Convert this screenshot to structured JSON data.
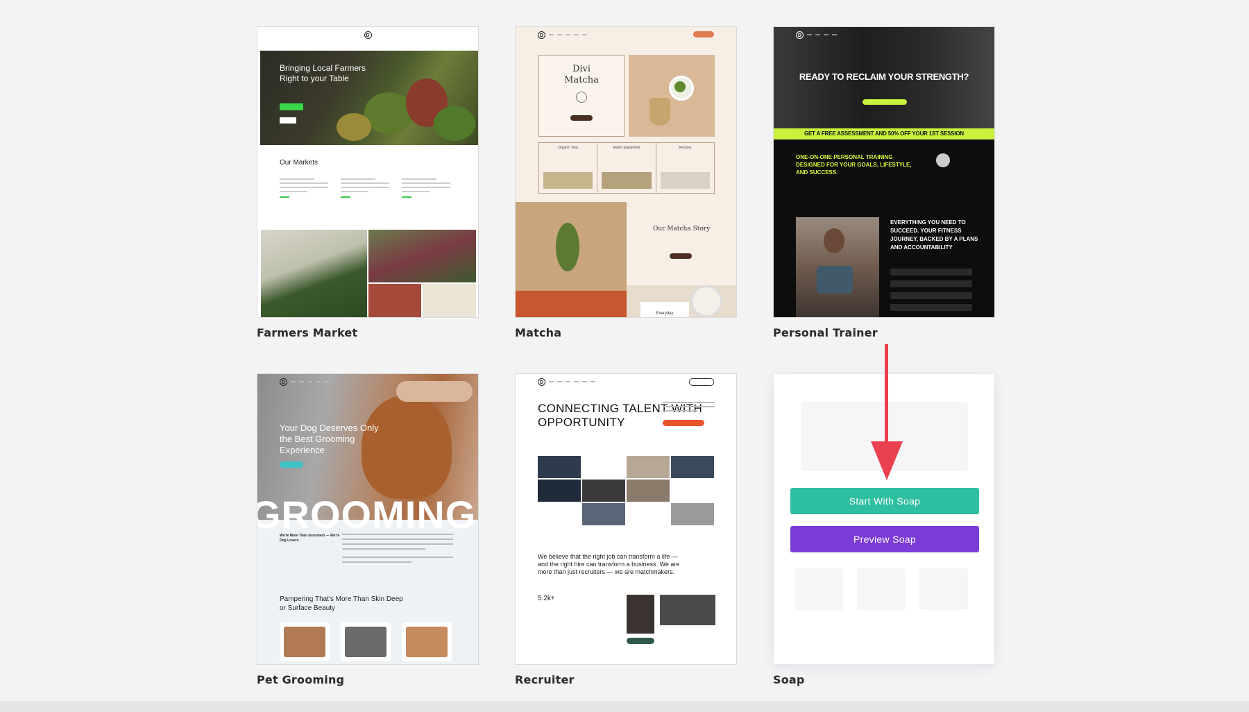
{
  "templates": [
    {
      "name": "Farmers Market",
      "preview": {
        "hero_title": "Bringing Local Farmers Right to your Table",
        "section_title": "Our Markets"
      }
    },
    {
      "name": "Matcha",
      "preview": {
        "brand_line1": "Divi",
        "brand_line2": "Matcha",
        "col1": "Organic Teas",
        "col2": "Match Equipment",
        "col3": "Recipes",
        "story_title": "Our Matcha Story",
        "bottom_label": "Everyday"
      }
    },
    {
      "name": "Personal Trainer",
      "preview": {
        "headline": "READY TO RECLAIM YOUR STRENGTH?",
        "banner": "GET A FREE ASSESSMENT AND 50% OFF YOUR 1ST SESSION",
        "subhead": "ONE-ON-ONE PERSONAL TRAINING DESIGNED FOR YOUR GOALS, LIFESTYLE, AND SUCCESS.",
        "feature_text": "EVERYTHING YOU NEED TO SUCCEED. YOUR FITNESS JOURNEY, BACKED BY A PLANS AND ACCOUNTABILITY"
      }
    },
    {
      "name": "Pet Grooming",
      "preview": {
        "hero_title": "Your Dog Deserves Only the Best Grooming Experience",
        "big_word": "GROOMING",
        "intro": "We're More Than Groomers — We're Dog Lovers",
        "section_title": "Pampering That's More Than Skin Deep or Surface Beauty"
      }
    },
    {
      "name": "Recruiter",
      "preview": {
        "headline": "CONNECTING TALENT WITH OPPORTUNITY",
        "paragraph": "We believe that the right job can transform a life — and the right hire can transform a business. We are more than just recruiters — we are matchmakers.",
        "stat": "5.2k+"
      }
    },
    {
      "name": "Soap",
      "start_button": "Start With Soap",
      "preview_button": "Preview Soap"
    }
  ],
  "colors": {
    "start_button": "#2ebfa0",
    "preview_button": "#7b3bd6",
    "annotation_arrow": "#ea3f4f"
  }
}
